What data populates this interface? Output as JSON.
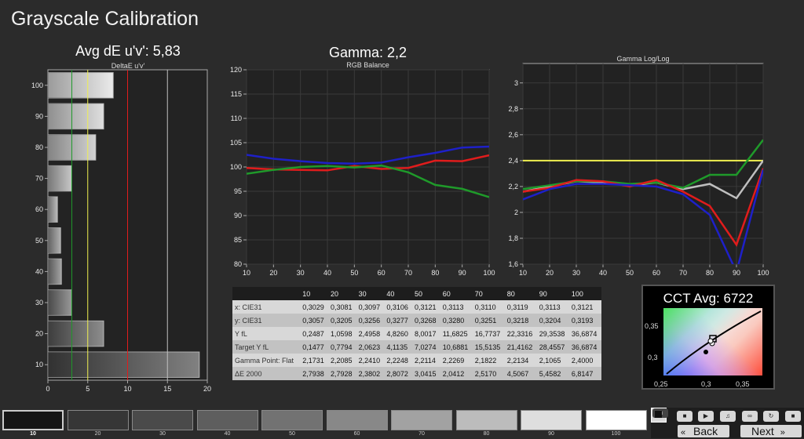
{
  "app": {
    "title": "Grayscale Calibration"
  },
  "colors": {
    "red": "#e01c1c",
    "green": "#1f9a2a",
    "blue": "#1e20c8",
    "yellow": "#f0f050",
    "gray": "#bfbfbf"
  },
  "chart_data": [
    {
      "type": "bar",
      "orientation": "horizontal",
      "title": "Avg dE u'v': 5,83",
      "subtitle": "DeltaE u'v'",
      "categories": [
        "100",
        "90",
        "80",
        "70",
        "60",
        "50",
        "40",
        "30",
        "20",
        "10"
      ],
      "values": [
        8.2,
        7.0,
        6.0,
        3.0,
        1.2,
        1.6,
        1.7,
        3.0,
        7.0,
        19.0
      ],
      "xlim": [
        0,
        20
      ],
      "xticks": [
        "0",
        "5",
        "10",
        "15",
        "20"
      ],
      "threshold_lines": [
        {
          "value": 3,
          "color": "green"
        },
        {
          "value": 5,
          "color": "yellow"
        },
        {
          "value": 10,
          "color": "red"
        },
        {
          "value": 15,
          "color": "gray"
        }
      ]
    },
    {
      "type": "line",
      "title": "Gamma: 2,2",
      "subtitle": "RGB Balance",
      "x": [
        10,
        20,
        30,
        40,
        50,
        60,
        70,
        80,
        90,
        100
      ],
      "xticks": [
        "10",
        "20",
        "30",
        "40",
        "50",
        "60",
        "70",
        "80",
        "90",
        "100"
      ],
      "yticks": [
        "80",
        "85",
        "90",
        "95",
        "100",
        "105",
        "110",
        "115",
        "120"
      ],
      "ylim": [
        80,
        120
      ],
      "series": [
        {
          "color": "red",
          "values": [
            99.8,
            99.5,
            99.4,
            99.3,
            100.2,
            99.6,
            99.8,
            101.3,
            101.2,
            102.4
          ]
        },
        {
          "color": "green",
          "values": [
            98.6,
            99.4,
            100.0,
            100.2,
            99.9,
            100.3,
            98.9,
            96.3,
            95.5,
            93.8
          ]
        },
        {
          "color": "blue",
          "values": [
            102.5,
            101.7,
            101.2,
            100.8,
            100.7,
            100.9,
            102.0,
            102.9,
            104.0,
            104.2
          ]
        }
      ]
    },
    {
      "type": "line",
      "subtitle": "Gamma Log/Log",
      "x": [
        10,
        20,
        30,
        40,
        50,
        60,
        70,
        80,
        90,
        100
      ],
      "xticks": [
        "10",
        "20",
        "30",
        "40",
        "50",
        "60",
        "70",
        "80",
        "90",
        "100"
      ],
      "yticks": [
        "1,6",
        "1,8",
        "2",
        "2,2",
        "2,4",
        "2,6",
        "2,8",
        "3"
      ],
      "ylim": [
        1.6,
        3.15
      ],
      "target": 2.4,
      "series": [
        {
          "color": "gray",
          "values": [
            2.16,
            2.2,
            2.24,
            2.23,
            2.21,
            2.23,
            2.18,
            2.22,
            2.11,
            2.4
          ]
        },
        {
          "color": "green",
          "values": [
            2.18,
            2.21,
            2.24,
            2.24,
            2.22,
            2.23,
            2.19,
            2.29,
            2.29,
            2.56
          ]
        },
        {
          "color": "red",
          "values": [
            2.16,
            2.19,
            2.25,
            2.24,
            2.2,
            2.25,
            2.16,
            2.05,
            1.75,
            2.34
          ]
        },
        {
          "color": "blue",
          "values": [
            2.1,
            2.18,
            2.22,
            2.22,
            2.21,
            2.2,
            2.14,
            1.98,
            1.54,
            2.33
          ]
        }
      ]
    }
  ],
  "table": {
    "headers": [
      "",
      "10",
      "20",
      "30",
      "40",
      "50",
      "60",
      "70",
      "80",
      "90",
      "100"
    ],
    "rows": [
      [
        "x: CIE31",
        "0,3029",
        "0,3081",
        "0,3097",
        "0,3106",
        "0,3121",
        "0,3113",
        "0,3110",
        "0,3119",
        "0,3113",
        "0,3121"
      ],
      [
        "y: CIE31",
        "0,3057",
        "0,3205",
        "0,3256",
        "0,3277",
        "0,3268",
        "0,3280",
        "0,3251",
        "0,3218",
        "0,3204",
        "0,3193"
      ],
      [
        "Y fL",
        "0,2487",
        "1,0598",
        "2,4958",
        "4,8260",
        "8,0017",
        "11,6825",
        "16,7737",
        "22,3316",
        "29,3538",
        "36,6874"
      ],
      [
        "Target Y fL",
        "0,1477",
        "0,7794",
        "2,0623",
        "4,1135",
        "7,0274",
        "10,6881",
        "15,5135",
        "21,4162",
        "28,4557",
        "36,6874"
      ],
      [
        "Gamma Point: Flat",
        "2,1731",
        "2,2085",
        "2,2410",
        "2,2248",
        "2,2114",
        "2,2269",
        "2,1822",
        "2,2134",
        "2,1065",
        "2,4000"
      ],
      [
        "ΔE 2000",
        "2,7938",
        "2,7928",
        "2,3802",
        "2,8072",
        "3,0415",
        "2,0412",
        "2,5170",
        "4,5067",
        "5,4582",
        "6,8147"
      ]
    ]
  },
  "cct": {
    "title": "CCT Avg: 6722",
    "xticks": [
      "0,25",
      "0,3",
      "0,35"
    ],
    "yticks": [
      "0,35",
      "0,3"
    ]
  },
  "swatches": {
    "items": [
      {
        "label": "10",
        "color": "#161616"
      },
      {
        "label": "20",
        "color": "#363636"
      },
      {
        "label": "30",
        "color": "#4a4a4a"
      },
      {
        "label": "40",
        "color": "#5e5e5e"
      },
      {
        "label": "50",
        "color": "#727272"
      },
      {
        "label": "60",
        "color": "#888888"
      },
      {
        "label": "70",
        "color": "#a2a2a2"
      },
      {
        "label": "80",
        "color": "#bcbcbc"
      },
      {
        "label": "90",
        "color": "#dedede"
      },
      {
        "label": "100",
        "color": "#ffffff"
      }
    ],
    "active_index": 0
  },
  "controls": {
    "back_label": "Back",
    "next_label": "Next",
    "back_icon": "double-chevron-left",
    "next_icon": "double-chevron-right"
  }
}
